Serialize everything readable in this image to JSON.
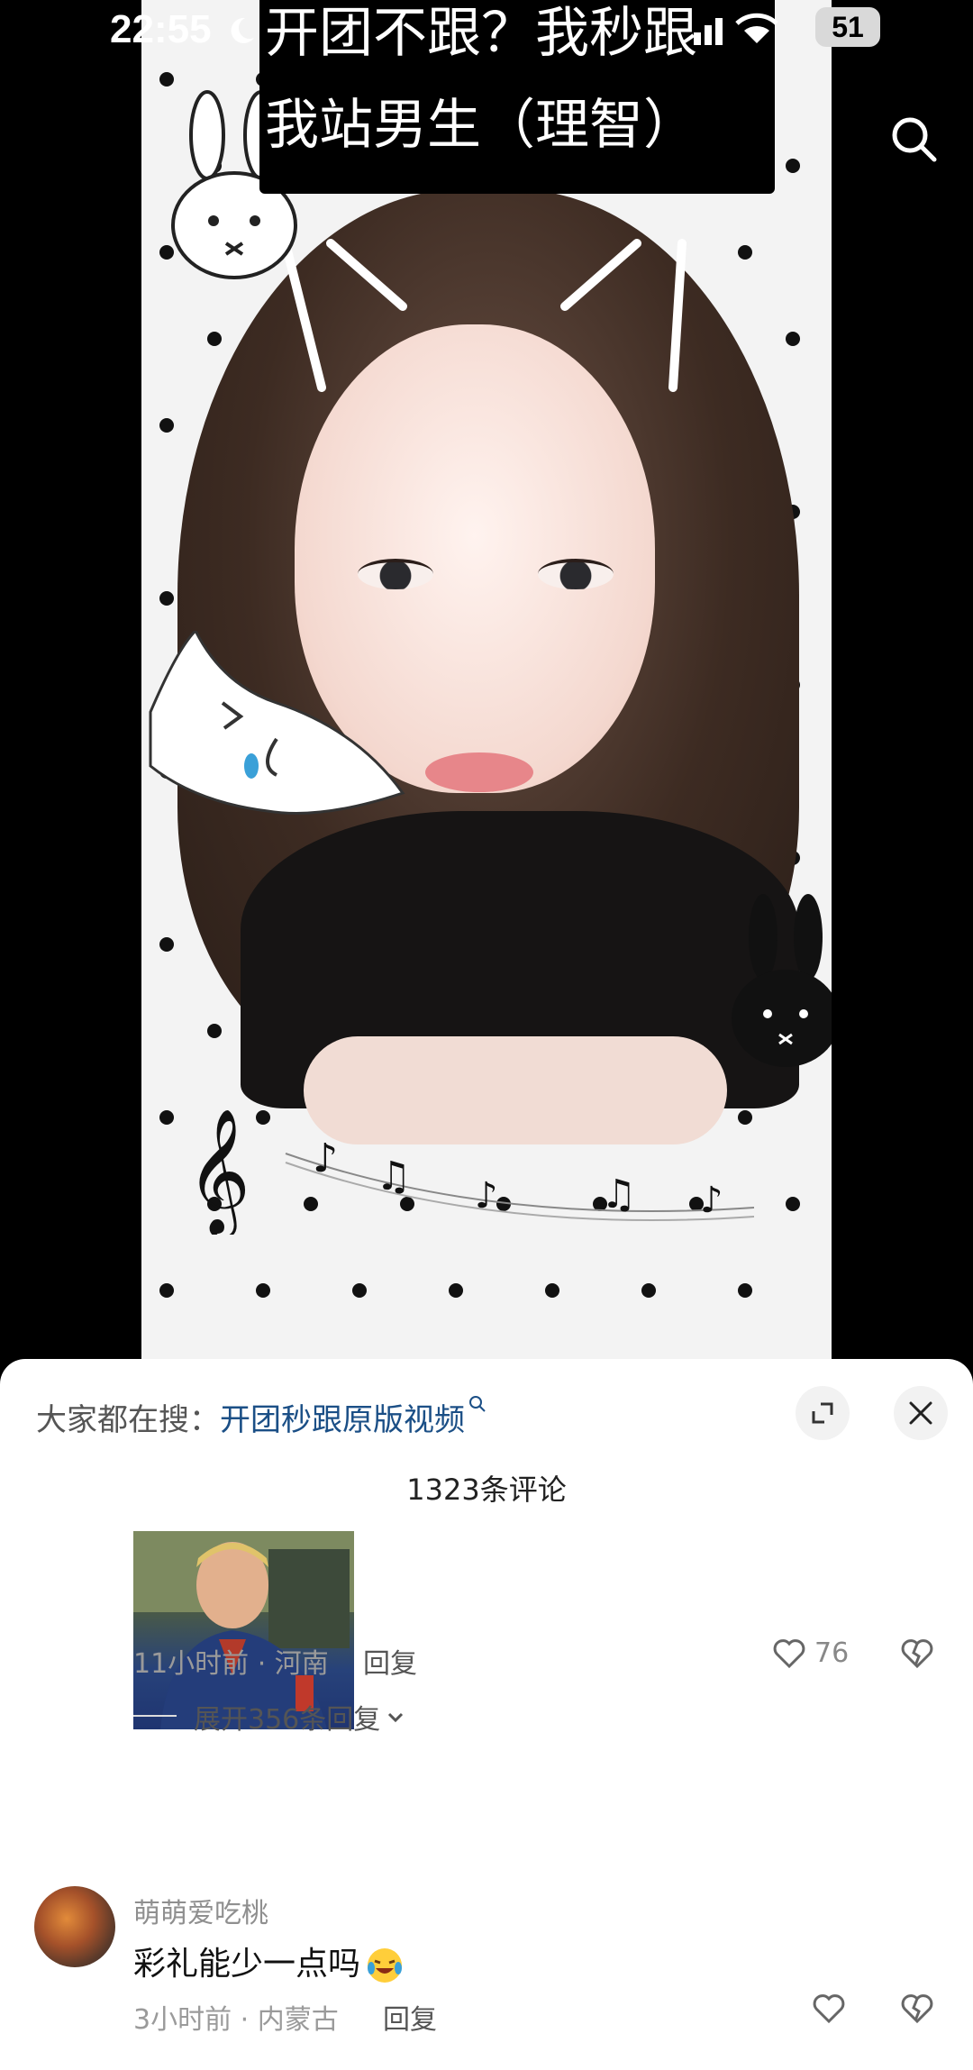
{
  "status_bar": {
    "time": "22:55",
    "battery": "51"
  },
  "video": {
    "caption_line1": "开团不跟？我秒跟",
    "caption_line2": "我站男生（理智）"
  },
  "sheet": {
    "search_prefix": "大家都在搜：",
    "search_term": "开团秒跟原版视频",
    "comment_count": "1323条评论",
    "comment1": {
      "time_location": "11小时前 · 河南",
      "reply_label": "回复",
      "likes": "76"
    },
    "expand_label": "展开356条回复",
    "comment2": {
      "username": "萌萌爱吃桃",
      "text": "彩礼能少一点吗",
      "time_location": "3小时前 · 内蒙古",
      "reply_label": "回复"
    }
  },
  "icons": {
    "search": "search-icon",
    "expand": "expand-icon",
    "close": "close-icon",
    "like": "heart-icon",
    "dislike": "broken-heart-icon"
  }
}
